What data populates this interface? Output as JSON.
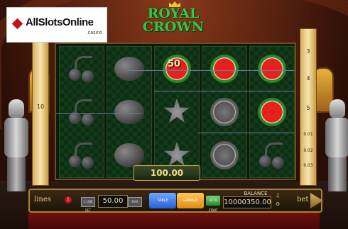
{
  "logo": {
    "text": "AllSlotsOnline",
    "sub": ".casino"
  },
  "game": {
    "title_line1": "ROYAL",
    "title_line2": "CROWN"
  },
  "left_lines": [
    {
      "label": "10",
      "active": true
    }
  ],
  "right_lines": [
    "3",
    "4",
    "5"
  ],
  "right_small": [
    "0.01",
    "0.02",
    "0.03"
  ],
  "reels": [
    [
      "cherry",
      "cherry",
      "cherry"
    ],
    [
      "lemon",
      "lemon",
      "lemon"
    ],
    [
      "watermelon-50",
      "star",
      "star"
    ],
    [
      "watermelon",
      "watermelon-gray",
      "watermelon-gray"
    ],
    [
      "watermelon",
      "watermelon",
      "cherry"
    ]
  ],
  "overlay_value": "50",
  "win_amount": "100.00",
  "panel": {
    "lines_label": "lines",
    "info_label": "i",
    "bet_minus_label": "1 LINE BET",
    "bet_value": "50.00",
    "bet_plus_label": "MAX",
    "table_label": "TABLE",
    "gamble_label": "GAMBLE",
    "auto_label": "AUTO START",
    "balance_label": "BALANCE",
    "balance_value": "10000350.00",
    "bet_label": "bet"
  }
}
